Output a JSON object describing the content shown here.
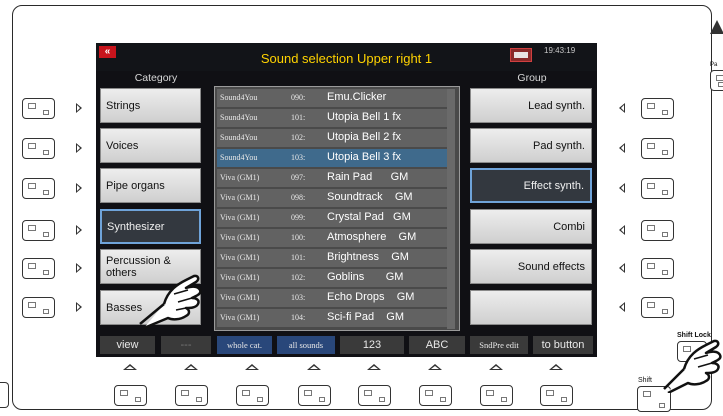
{
  "screen": {
    "title": "Sound selection Upper right 1",
    "clock": "19:43:19",
    "back_symbol": "«",
    "category_header": "Category",
    "group_header": "Group",
    "categories": [
      {
        "label": "Strings",
        "selected": false
      },
      {
        "label": "Voices",
        "selected": false
      },
      {
        "label": "Pipe organs",
        "selected": false
      },
      {
        "label": "Synthesizer",
        "selected": true
      },
      {
        "label": "Percussion & others",
        "selected": false
      },
      {
        "label": "Basses",
        "selected": false
      }
    ],
    "groups": [
      {
        "label": "Lead synth.",
        "selected": false
      },
      {
        "label": "Pad synth.",
        "selected": false
      },
      {
        "label": "Effect synth.",
        "selected": true
      },
      {
        "label": "Combi",
        "selected": false
      },
      {
        "label": "Sound effects",
        "selected": false
      },
      {
        "label": "",
        "selected": false
      }
    ],
    "sounds": [
      {
        "source": "Sound4You",
        "number": "090:",
        "name": "Emu.Clicker",
        "selected": false
      },
      {
        "source": "Sound4You",
        "number": "101:",
        "name": "Utopia Bell 1 fx",
        "selected": false
      },
      {
        "source": "Sound4You",
        "number": "102:",
        "name": "Utopia Bell 2 fx",
        "selected": false
      },
      {
        "source": "Sound4You",
        "number": "103:",
        "name": "Utopia Bell 3 fx",
        "selected": true
      },
      {
        "source": "Viva (GM1)",
        "number": "097:",
        "name": "Rain Pad      GM",
        "selected": false
      },
      {
        "source": "Viva (GM1)",
        "number": "098:",
        "name": "Soundtrack    GM",
        "selected": false
      },
      {
        "source": "Viva (GM1)",
        "number": "099:",
        "name": "Crystal Pad   GM",
        "selected": false
      },
      {
        "source": "Viva (GM1)",
        "number": "100:",
        "name": "Atmosphere    GM",
        "selected": false
      },
      {
        "source": "Viva (GM1)",
        "number": "101:",
        "name": "Brightness    GM",
        "selected": false
      },
      {
        "source": "Viva (GM1)",
        "number": "102:",
        "name": "Goblins       GM",
        "selected": false
      },
      {
        "source": "Viva (GM1)",
        "number": "103:",
        "name": "Echo Drops    GM",
        "selected": false
      },
      {
        "source": "Viva (GM1)",
        "number": "104:",
        "name": "Sci-fi Pad    GM",
        "selected": false
      }
    ],
    "softkeys": [
      "view",
      "---",
      "whole cat.",
      "all sounds",
      "123",
      "ABC",
      "SndPre edit",
      "to button"
    ]
  },
  "panel": {
    "shift_lock_label": "Shift Lock",
    "shift_label": "Shift",
    "pa_label": "Pa"
  },
  "colors": {
    "title": "#ffd300",
    "selected_row": "#3f6a8c",
    "highlight_border": "#6fa3d9",
    "back_button": "#c8141c"
  }
}
